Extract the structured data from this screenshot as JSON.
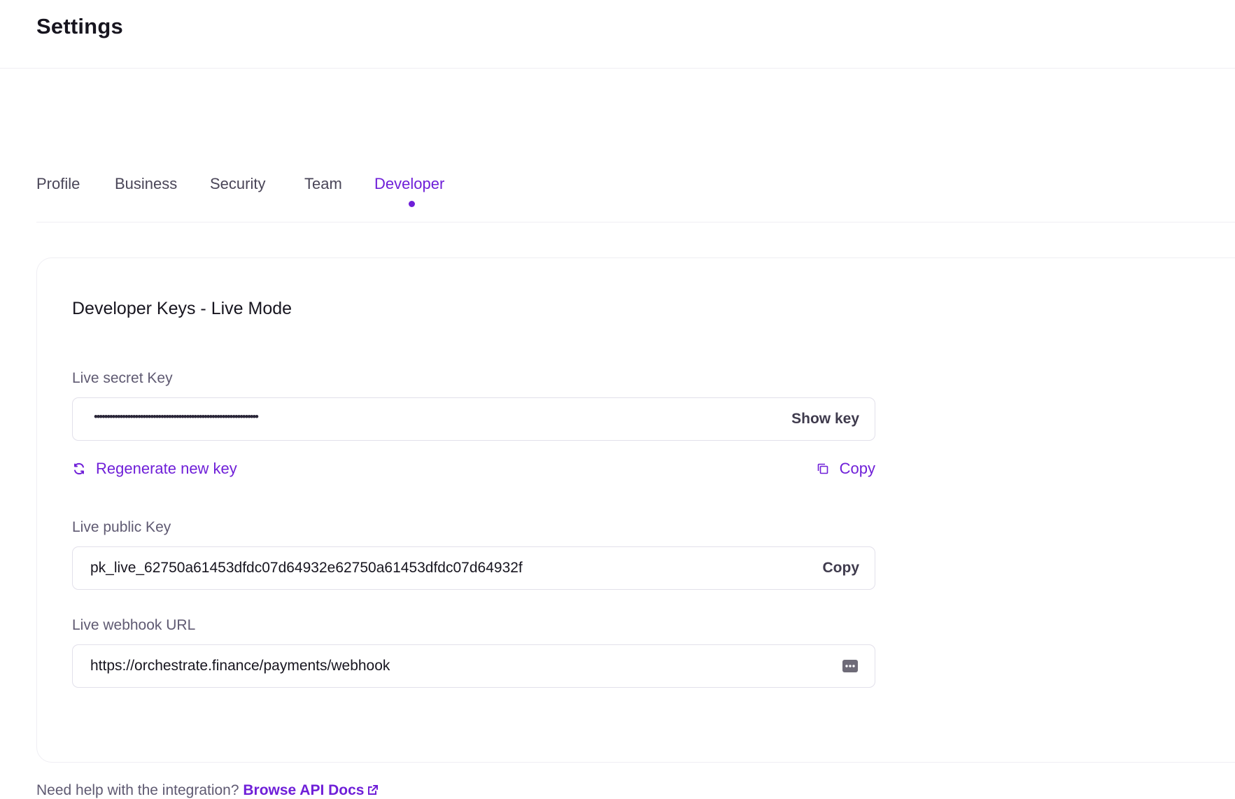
{
  "header": {
    "title": "Settings"
  },
  "tabs": [
    {
      "label": "Profile",
      "active": false
    },
    {
      "label": "Business",
      "active": false
    },
    {
      "label": "Security",
      "active": false
    },
    {
      "label": "Team",
      "active": false
    },
    {
      "label": "Developer",
      "active": true
    }
  ],
  "card": {
    "title": "Developer Keys - Live Mode",
    "secret_key": {
      "label": "Live secret Key",
      "value": "••••••••••••••••••••••••••••••••••••••••••••••••••••••••••••••••",
      "action": "Show key",
      "regenerate_label": "Regenerate new key",
      "copy_label": "Copy"
    },
    "public_key": {
      "label": "Live public Key",
      "value": "pk_live_62750a61453dfdc07d64932e62750a61453dfdc07d64932f",
      "action": "Copy"
    },
    "webhook": {
      "label": "Live webhook URL",
      "value": "https://orchestrate.finance/payments/webhook",
      "icon": "more-icon"
    }
  },
  "help": {
    "text": "Need help with the integration?",
    "link_label": "Browse API Docs"
  },
  "colors": {
    "accent": "#6f1fd8",
    "text": "#17151f",
    "muted": "#5f5a72",
    "border": "#e2e0ea"
  }
}
